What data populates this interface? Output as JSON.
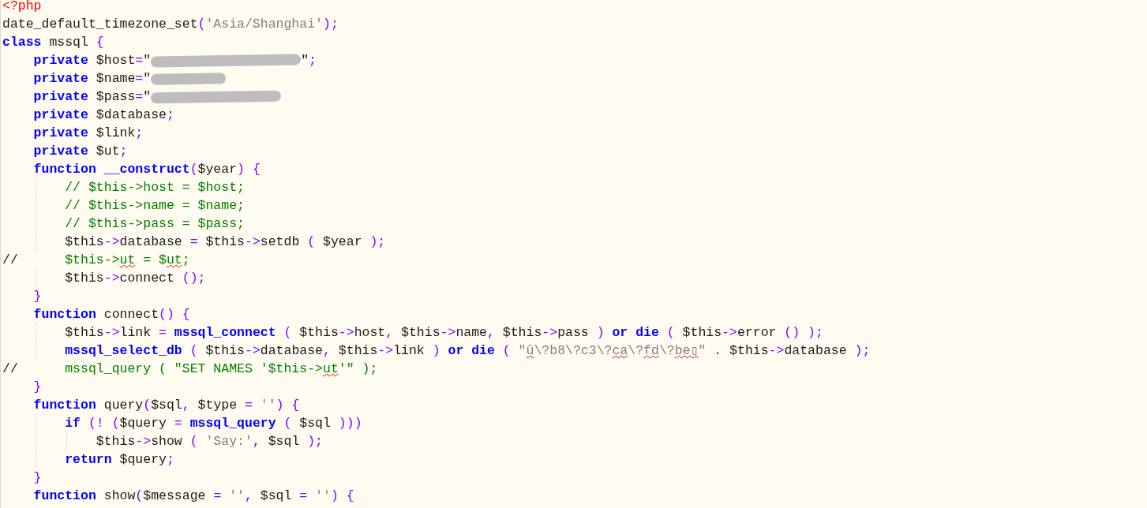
{
  "editor": {
    "lines": [
      {
        "tokens": [
          {
            "text": "<?php",
            "kind": "tag"
          }
        ]
      },
      {
        "tokens": [
          {
            "text": "date_default_timezone_set",
            "kind": "plain"
          },
          {
            "text": "(",
            "kind": "operator"
          },
          {
            "text": "'Asia/Shanghai'",
            "kind": "string"
          },
          {
            "text": ");",
            "kind": "operator"
          }
        ]
      },
      {
        "tokens": [
          {
            "text": "class",
            "kind": "keyword"
          },
          {
            "text": " mssql ",
            "kind": "plain"
          },
          {
            "text": "{",
            "kind": "operator"
          }
        ]
      },
      {
        "tokens": [
          {
            "text": "    private",
            "kind": "keyword"
          },
          {
            "text": " $host",
            "kind": "plain"
          },
          {
            "text": "=",
            "kind": "operator"
          },
          {
            "text": "\"",
            "kind": "plain"
          },
          {
            "kind": "redaction"
          },
          {
            "text": "\"",
            "kind": "plain"
          },
          {
            "text": ";",
            "kind": "operator"
          }
        ]
      },
      {
        "tokens": [
          {
            "text": "    private",
            "kind": "keyword"
          },
          {
            "text": " $name",
            "kind": "plain"
          },
          {
            "text": "=",
            "kind": "operator"
          },
          {
            "text": "\"",
            "kind": "plain"
          },
          {
            "kind": "redaction"
          }
        ]
      },
      {
        "tokens": [
          {
            "text": "    private",
            "kind": "keyword"
          },
          {
            "text": " $pass",
            "kind": "plain"
          },
          {
            "text": "=",
            "kind": "operator"
          },
          {
            "text": "\"",
            "kind": "plain"
          },
          {
            "kind": "redaction"
          }
        ]
      },
      {
        "tokens": [
          {
            "text": "    private",
            "kind": "keyword"
          },
          {
            "text": " $database",
            "kind": "plain"
          },
          {
            "text": ";",
            "kind": "operator"
          }
        ]
      },
      {
        "tokens": [
          {
            "text": "    private",
            "kind": "keyword"
          },
          {
            "text": " $link",
            "kind": "plain"
          },
          {
            "text": ";",
            "kind": "operator"
          }
        ]
      },
      {
        "tokens": [
          {
            "text": "    private",
            "kind": "keyword"
          },
          {
            "text": " $ut",
            "kind": "plain"
          },
          {
            "text": ";",
            "kind": "operator"
          }
        ]
      },
      {
        "tokens": [
          {
            "text": "    function",
            "kind": "keyword"
          },
          {
            "text": " __construct",
            "kind": "keyword"
          },
          {
            "text": "(",
            "kind": "operator"
          },
          {
            "text": "$year",
            "kind": "plain"
          },
          {
            "text": ") {",
            "kind": "operator"
          }
        ]
      },
      {
        "tokens": [
          {
            "text": "        // $this->host = $host;",
            "kind": "comment"
          }
        ]
      },
      {
        "tokens": [
          {
            "text": "        // $this->name = $name;",
            "kind": "comment"
          }
        ]
      },
      {
        "tokens": [
          {
            "text": "        // $this->pass = $pass;",
            "kind": "comment"
          }
        ]
      },
      {
        "tokens": [
          {
            "text": "        $this",
            "kind": "plain"
          },
          {
            "text": "->",
            "kind": "operator"
          },
          {
            "text": "database ",
            "kind": "plain"
          },
          {
            "text": "=",
            "kind": "operator"
          },
          {
            "text": " $this",
            "kind": "plain"
          },
          {
            "text": "->",
            "kind": "operator"
          },
          {
            "text": "setdb ",
            "kind": "plain"
          },
          {
            "text": "(",
            "kind": "operator"
          },
          {
            "text": " $year ",
            "kind": "plain"
          },
          {
            "text": ");",
            "kind": "operator"
          }
        ]
      },
      {
        "tokens": [
          {
            "text": "//      ",
            "kind": "plain"
          },
          {
            "text": "$this->",
            "kind": "comment"
          },
          {
            "text": "ut",
            "kind": "comment",
            "misspelled": true
          },
          {
            "text": " = $",
            "kind": "comment"
          },
          {
            "text": "ut",
            "kind": "comment",
            "misspelled": true
          },
          {
            "text": ";",
            "kind": "comment"
          }
        ]
      },
      {
        "tokens": [
          {
            "text": "        $this",
            "kind": "plain"
          },
          {
            "text": "->",
            "kind": "operator"
          },
          {
            "text": "connect ",
            "kind": "plain"
          },
          {
            "text": "();",
            "kind": "operator"
          }
        ]
      },
      {
        "tokens": [
          {
            "text": "    }",
            "kind": "operator"
          }
        ]
      },
      {
        "tokens": [
          {
            "text": "    function",
            "kind": "keyword"
          },
          {
            "text": " connect",
            "kind": "plain"
          },
          {
            "text": "() {",
            "kind": "operator"
          }
        ]
      },
      {
        "tokens": [
          {
            "text": "        $this",
            "kind": "plain"
          },
          {
            "text": "->",
            "kind": "operator"
          },
          {
            "text": "link ",
            "kind": "plain"
          },
          {
            "text": "=",
            "kind": "operator"
          },
          {
            "text": " mssql_connect",
            "kind": "keyword"
          },
          {
            "text": " (",
            "kind": "operator"
          },
          {
            "text": " $this",
            "kind": "plain"
          },
          {
            "text": "->",
            "kind": "operator"
          },
          {
            "text": "host",
            "kind": "plain"
          },
          {
            "text": ",",
            "kind": "operator"
          },
          {
            "text": " $this",
            "kind": "plain"
          },
          {
            "text": "->",
            "kind": "operator"
          },
          {
            "text": "name",
            "kind": "plain"
          },
          {
            "text": ",",
            "kind": "operator"
          },
          {
            "text": " $this",
            "kind": "plain"
          },
          {
            "text": "->",
            "kind": "operator"
          },
          {
            "text": "pass ",
            "kind": "plain"
          },
          {
            "text": ")",
            "kind": "operator"
          },
          {
            "text": " or die",
            "kind": "keyword"
          },
          {
            "text": " (",
            "kind": "operator"
          },
          {
            "text": " $this",
            "kind": "plain"
          },
          {
            "text": "->",
            "kind": "operator"
          },
          {
            "text": "error ",
            "kind": "plain"
          },
          {
            "text": "() );",
            "kind": "operator"
          }
        ]
      },
      {
        "tokens": [
          {
            "text": "        mssql_select_db",
            "kind": "keyword"
          },
          {
            "text": " (",
            "kind": "operator"
          },
          {
            "text": " $this",
            "kind": "plain"
          },
          {
            "text": "->",
            "kind": "operator"
          },
          {
            "text": "database",
            "kind": "plain"
          },
          {
            "text": ",",
            "kind": "operator"
          },
          {
            "text": " $this",
            "kind": "plain"
          },
          {
            "text": "->",
            "kind": "operator"
          },
          {
            "text": "link ",
            "kind": "plain"
          },
          {
            "text": ")",
            "kind": "operator"
          },
          {
            "text": " or die",
            "kind": "keyword"
          },
          {
            "text": " (",
            "kind": "operator"
          },
          {
            "text": " \"",
            "kind": "string"
          },
          {
            "text": "û",
            "kind": "string",
            "misspelled": true
          },
          {
            "text": "\\?b8\\?c3\\?",
            "kind": "string"
          },
          {
            "text": "ca",
            "kind": "string",
            "misspelled": true
          },
          {
            "text": "\\?",
            "kind": "string"
          },
          {
            "text": "fd",
            "kind": "string",
            "misspelled": true
          },
          {
            "text": "\\?",
            "kind": "string"
          },
          {
            "text": "be▯",
            "kind": "string",
            "misspelled": true
          },
          {
            "text": "\"",
            "kind": "string"
          },
          {
            "text": " .",
            "kind": "operator"
          },
          {
            "text": " $this",
            "kind": "plain"
          },
          {
            "text": "->",
            "kind": "operator"
          },
          {
            "text": "database ",
            "kind": "plain"
          },
          {
            "text": ");",
            "kind": "operator"
          }
        ]
      },
      {
        "tokens": [
          {
            "text": "//      ",
            "kind": "plain"
          },
          {
            "text": "mssql_query ( \"SET NAMES '$this->",
            "kind": "comment"
          },
          {
            "text": "ut",
            "kind": "comment",
            "misspelled": true
          },
          {
            "text": "'\" );",
            "kind": "comment"
          }
        ]
      },
      {
        "tokens": [
          {
            "text": "    }",
            "kind": "operator"
          }
        ]
      },
      {
        "tokens": [
          {
            "text": "    function",
            "kind": "keyword"
          },
          {
            "text": " query",
            "kind": "plain"
          },
          {
            "text": "(",
            "kind": "operator"
          },
          {
            "text": "$sql",
            "kind": "plain"
          },
          {
            "text": ",",
            "kind": "operator"
          },
          {
            "text": " $type ",
            "kind": "plain"
          },
          {
            "text": "=",
            "kind": "operator"
          },
          {
            "text": " ''",
            "kind": "string"
          },
          {
            "text": ") {",
            "kind": "operator"
          }
        ]
      },
      {
        "tokens": [
          {
            "text": "        if",
            "kind": "keyword"
          },
          {
            "text": " (! (",
            "kind": "operator"
          },
          {
            "text": "$query ",
            "kind": "plain"
          },
          {
            "text": "=",
            "kind": "operator"
          },
          {
            "text": " mssql_query",
            "kind": "keyword"
          },
          {
            "text": " (",
            "kind": "operator"
          },
          {
            "text": " $sql ",
            "kind": "plain"
          },
          {
            "text": ")))",
            "kind": "operator"
          }
        ]
      },
      {
        "tokens": [
          {
            "text": "            $this",
            "kind": "plain"
          },
          {
            "text": "->",
            "kind": "operator"
          },
          {
            "text": "show ",
            "kind": "plain"
          },
          {
            "text": "(",
            "kind": "operator"
          },
          {
            "text": " 'Say:'",
            "kind": "string"
          },
          {
            "text": ",",
            "kind": "operator"
          },
          {
            "text": " $sql ",
            "kind": "plain"
          },
          {
            "text": ");",
            "kind": "operator"
          }
        ]
      },
      {
        "tokens": [
          {
            "text": "        return",
            "kind": "keyword"
          },
          {
            "text": " $query",
            "kind": "plain"
          },
          {
            "text": ";",
            "kind": "operator"
          }
        ]
      },
      {
        "tokens": [
          {
            "text": "    }",
            "kind": "operator"
          }
        ]
      },
      {
        "tokens": [
          {
            "text": "    function",
            "kind": "keyword"
          },
          {
            "text": " show",
            "kind": "plain"
          },
          {
            "text": "(",
            "kind": "operator"
          },
          {
            "text": "$message ",
            "kind": "plain"
          },
          {
            "text": "=",
            "kind": "operator"
          },
          {
            "text": " ''",
            "kind": "string"
          },
          {
            "text": ",",
            "kind": "operator"
          },
          {
            "text": " $sql ",
            "kind": "plain"
          },
          {
            "text": "=",
            "kind": "operator"
          },
          {
            "text": " ''",
            "kind": "string"
          },
          {
            "text": ") {",
            "kind": "operator"
          }
        ]
      }
    ]
  }
}
